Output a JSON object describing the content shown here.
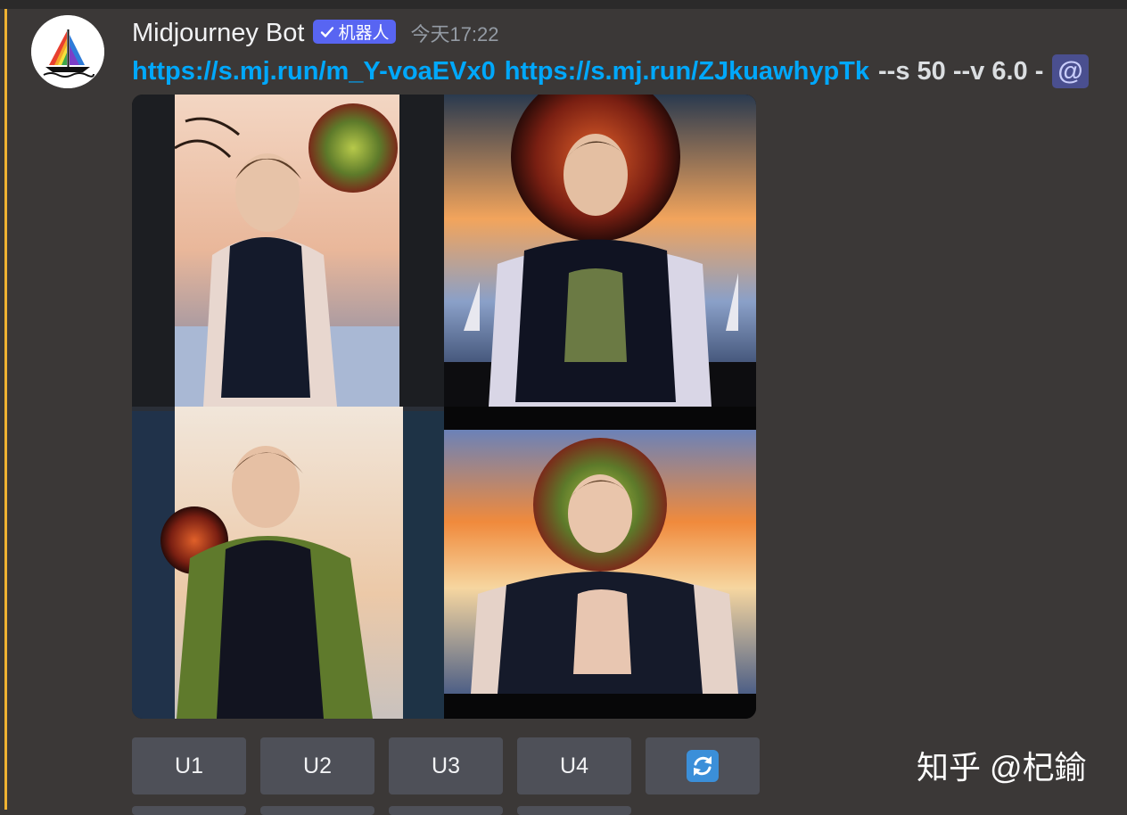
{
  "message": {
    "author": "Midjourney Bot",
    "bot_tag": "机器人",
    "timestamp": "今天17:22",
    "prompt": {
      "link1": "https://s.mj.run/m_Y-voaEVx0",
      "link2": "https://s.mj.run/ZJkuawhypTk",
      "params": "--s 50 --v 6.0 -",
      "mention_prefix": "@"
    }
  },
  "buttons": {
    "u1": "U1",
    "u2": "U2",
    "u3": "U3",
    "u4": "U4",
    "reroll_icon": "refresh-icon"
  },
  "watermark": "知乎 @杞鍮",
  "colors": {
    "highlight_bar": "#f0b232",
    "link": "#00a8fc",
    "bot_tag": "#5865f2",
    "button": "#4e5058",
    "background": "#3b3837"
  }
}
